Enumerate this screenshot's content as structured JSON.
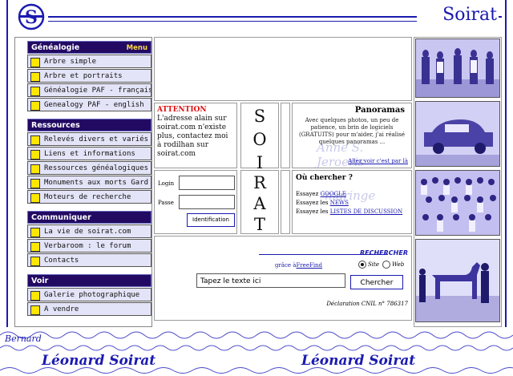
{
  "site": {
    "title": "Soirat"
  },
  "menu": {
    "sections": [
      {
        "label": "Généalogie",
        "extra": "Menu",
        "items": [
          "Arbre simple",
          "Arbre et portraits",
          "Généalogie PAF - français",
          "Genealogy PAF - english"
        ]
      },
      {
        "label": "Ressources",
        "items": [
          "Relevés divers et variés",
          "Liens et informations",
          "Ressources généalogiques",
          "Monuments aux morts Gard",
          "Moteurs de recherche"
        ]
      },
      {
        "label": "Communiquer",
        "items": [
          "La vie de soirat.com",
          "Verbaroom : le forum",
          "Contacts"
        ]
      },
      {
        "label": "Voir",
        "items": [
          "Galerie photographique",
          "A vendre"
        ]
      }
    ]
  },
  "attention": {
    "heading": "ATTENTION",
    "text": "L'adresse alain sur soirat.com n'existe plus, contactez moi à rodilhan sur soirat.com"
  },
  "vertical_top": [
    "S",
    "O",
    "I"
  ],
  "vertical_bottom": [
    "R",
    "A",
    "T"
  ],
  "panoramas": {
    "title": "Panoramas",
    "text": "Avec quelques photos, un peu de patience, un brin de logiciels (GRATUITS) pour m'aider, j'ai réalisé quelques panoramas ...",
    "link": "Allez voir c'est par là"
  },
  "login": {
    "login_label": "Login",
    "password_label": "Passe",
    "button": "Identification"
  },
  "ou_chercher": {
    "title": "Où chercher ?",
    "line1_prefix": "Essayez ",
    "line1_link": "GOOGLE",
    "line2_prefix": "Essayez les ",
    "line2_link": "NEWS",
    "line3_prefix": "Essayez les ",
    "line3_link": "LISTES DE DISCUSSION"
  },
  "search": {
    "header": "RECHERCHER",
    "powered_prefix": "grâce à",
    "powered_link": "FreeFind",
    "option_site": "Site",
    "option_web": "Web",
    "input_value": "Tapez le texte ici",
    "button": "Chercher",
    "cnil": "Déclaration CNIL n° 786317"
  },
  "background_script": {
    "signature_left": "Léonard Soirat",
    "signature_right": "Léonard Soirat",
    "fragment": "Bernard"
  },
  "colors": {
    "menu_section_bg": "#220a63",
    "menu_item_bg": "#e4e4f8",
    "accent": "#1a1ab0",
    "attention": "#e01010",
    "square": "#ffe600"
  }
}
